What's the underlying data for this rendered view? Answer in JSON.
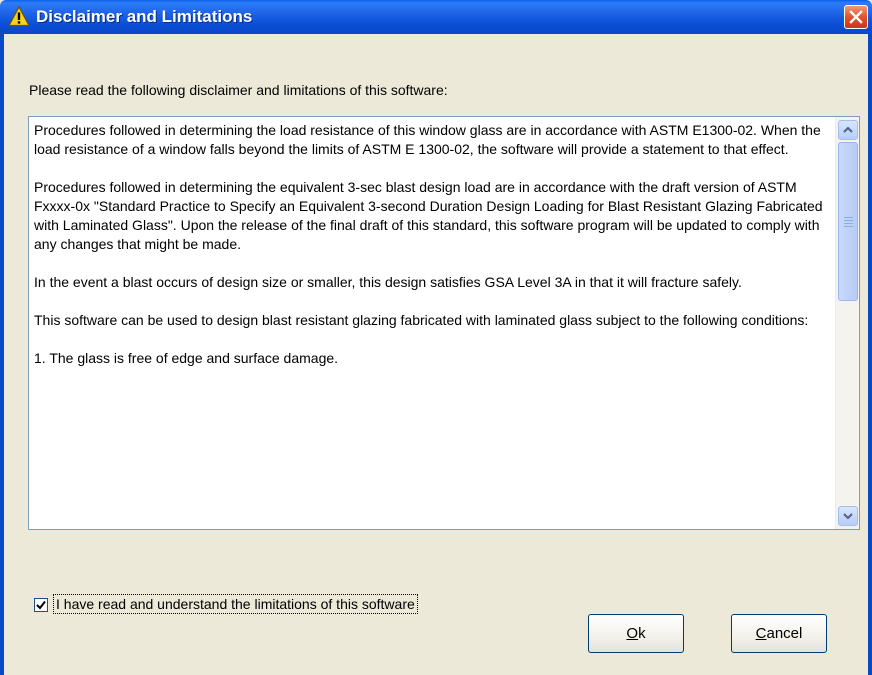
{
  "window": {
    "title": "Disclaimer and Limitations",
    "icon": "warning-icon"
  },
  "intro": "Please read the following disclaimer and limitations of this software:",
  "disclaimer": {
    "paragraphs": [
      "Procedures followed in determining the load resistance of this window glass are in accordance with ASTM E1300-02.  When the load resistance of a window falls beyond the limits of ASTM E 1300-02, the software will provide a statement to that effect.",
      "Procedures followed in determining the equivalent 3-sec blast design load are in accordance with the draft version of ASTM Fxxxx-0x \"Standard Practice to Specify an Equivalent 3-second Duration Design Loading for Blast Resistant Glazing Fabricated with Laminated Glass\".  Upon the release of the final draft of this standard, this software program will be updated to comply with any changes that might be made.",
      "In the event a blast occurs of design size or smaller, this design satisfies GSA Level 3A in that it will fracture safely.",
      "This software can be used to design blast resistant glazing fabricated with laminated glass subject to the following conditions:",
      "1.  The glass is free of edge and surface damage."
    ]
  },
  "acknowledge": {
    "label": "I have read and understand the limitations of this software",
    "checked": true
  },
  "buttons": {
    "ok_mnemonic": "O",
    "ok_rest": "k",
    "cancel_mnemonic": "C",
    "cancel_rest": "ancel"
  },
  "colors": {
    "titlebar": "#0b4fd6",
    "close": "#e2522c",
    "dialog_bg": "#ece9d8"
  }
}
